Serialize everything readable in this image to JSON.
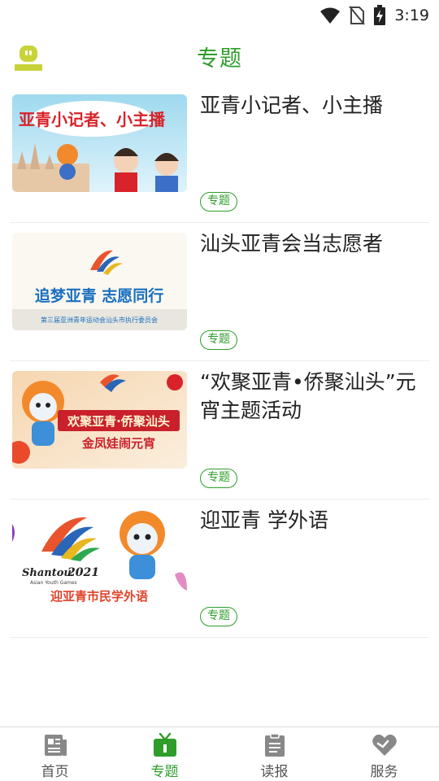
{
  "status_bar": {
    "time": "3:19"
  },
  "header": {
    "title": "专题"
  },
  "articles": [
    {
      "title": "亚青小记者、小主播",
      "tag": "专题",
      "thumb_text": "亚青小记者、小主播"
    },
    {
      "title": "汕头亚青会当志愿者",
      "tag": "专题",
      "thumb_text": "追梦亚青  志愿同行",
      "thumb_sub": "第三届亚洲青年运动会汕头市执行委员会"
    },
    {
      "title": "“欢聚亚青•侨聚汕头”元宵主题活动",
      "tag": "专题",
      "thumb_text": "欢聚亚青·侨聚汕头",
      "thumb_sub": "金凤娃闹元宵"
    },
    {
      "title": "迎亚青 学外语",
      "tag": "专题",
      "thumb_text": "迎亚青市民学外语"
    }
  ],
  "bottom_nav": [
    {
      "label": "首页"
    },
    {
      "label": "专题"
    },
    {
      "label": "读报"
    },
    {
      "label": "服务"
    }
  ],
  "colors": {
    "accent": "#2e9d2a",
    "logo_yellow": "#c8d33a"
  }
}
